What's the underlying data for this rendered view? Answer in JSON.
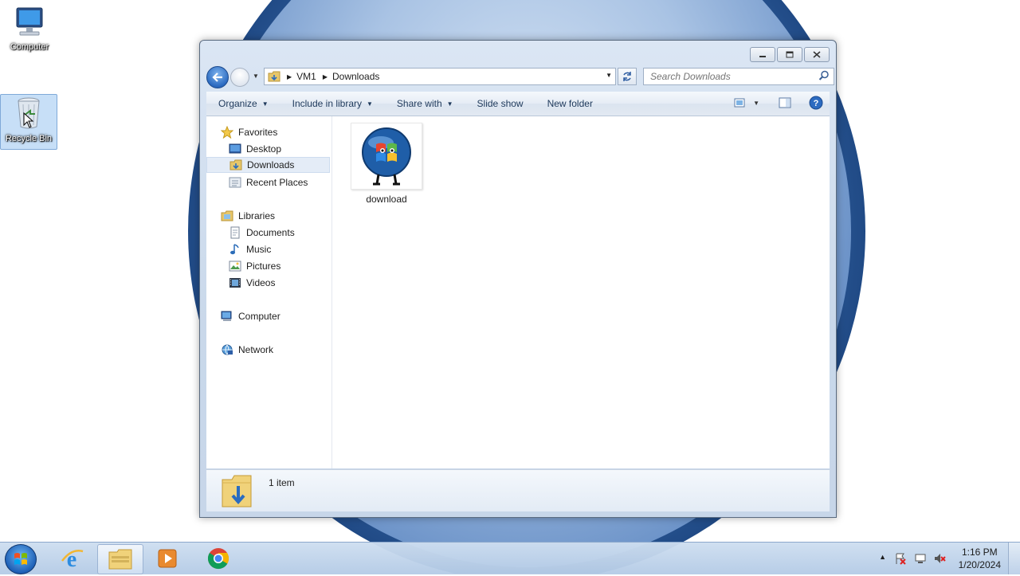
{
  "desktop": {
    "icons": [
      {
        "label": "Computer"
      },
      {
        "label": "Recycle Bin"
      }
    ]
  },
  "window": {
    "address": {
      "crumbs": [
        "VM1",
        "Downloads"
      ]
    },
    "search": {
      "placeholder": "Search Downloads"
    },
    "toolbar": {
      "organize": "Organize",
      "include_in_library": "Include in library",
      "share_with": "Share with",
      "slide_show": "Slide show",
      "new_folder": "New folder"
    },
    "nav": {
      "favorites": "Favorites",
      "desktop": "Desktop",
      "downloads": "Downloads",
      "recent_places": "Recent Places",
      "libraries": "Libraries",
      "documents": "Documents",
      "music": "Music",
      "pictures": "Pictures",
      "videos": "Videos",
      "computer": "Computer",
      "network": "Network"
    },
    "files": [
      {
        "name": "download"
      }
    ],
    "details": {
      "count": "1 item"
    }
  },
  "taskbar": {
    "apps": [
      "internet-explorer",
      "windows-explorer",
      "media-player",
      "chrome"
    ],
    "clock": {
      "time": "1:16 PM",
      "date": "1/20/2024"
    }
  },
  "colors": {
    "accent": "#2c6bc1",
    "taskbar": "#c6d8ee",
    "selection": "#e4ecf7"
  }
}
